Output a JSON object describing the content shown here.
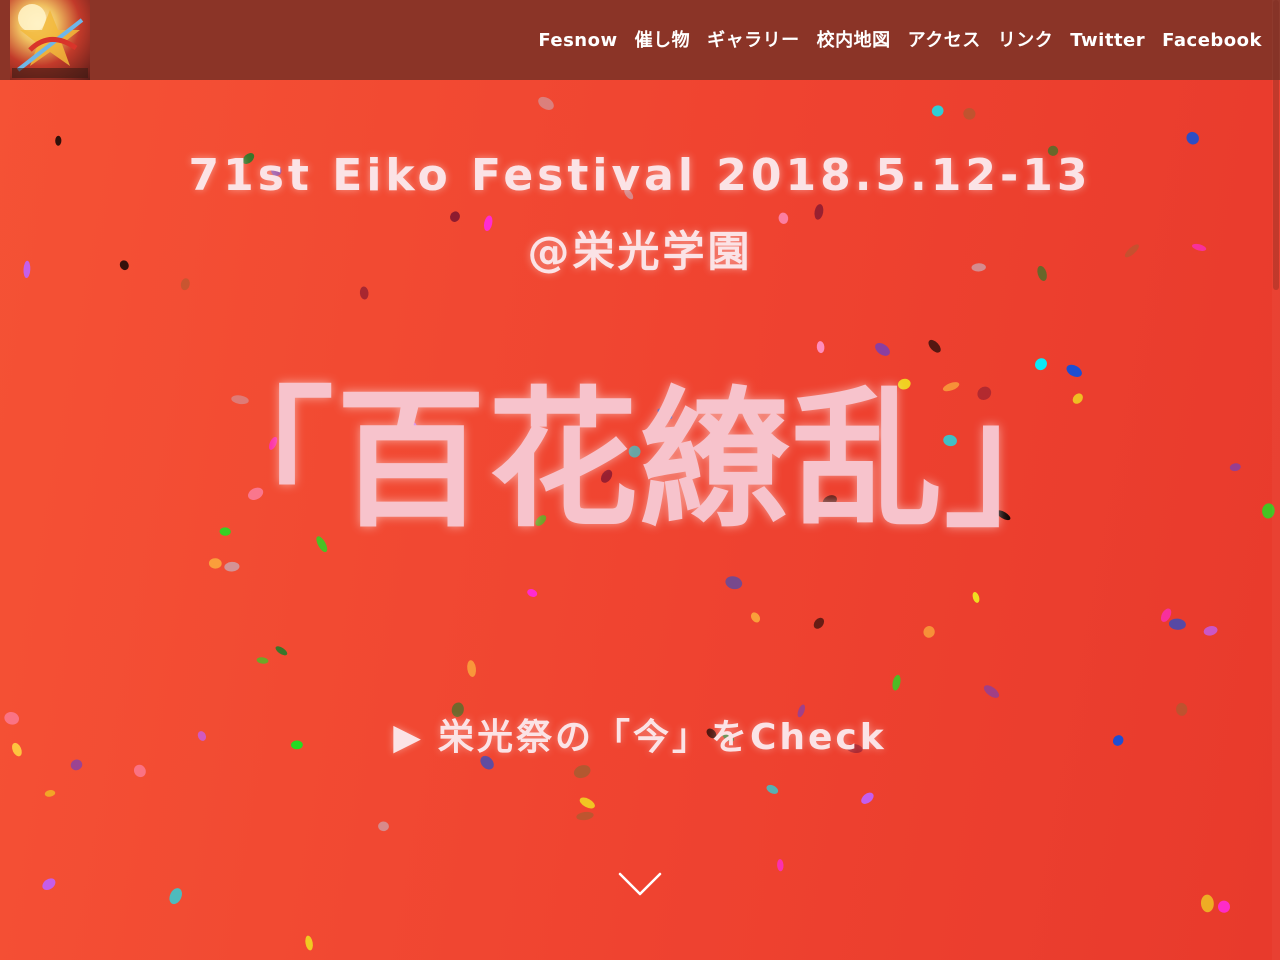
{
  "header": {
    "logo_alt": "栄光祭 logo",
    "nav": [
      {
        "label": "Fesnow"
      },
      {
        "label": "催し物"
      },
      {
        "label": "ギャラリー"
      },
      {
        "label": "校内地図"
      },
      {
        "label": "アクセス"
      },
      {
        "label": "リンク"
      },
      {
        "label": "Twitter"
      },
      {
        "label": "Facebook"
      }
    ]
  },
  "hero": {
    "line1": "71st Eiko Festival 2018.5.12-13",
    "line2": "@栄光学園",
    "title": "「百花繚乱」",
    "check_arrow": "▶",
    "check_label": "栄光祭の「今」をCheck",
    "scroll_icon": "chevron-down-icon"
  },
  "colors": {
    "background": "#ef4330",
    "header": "#8b3427",
    "title": "#f7c3cc",
    "text": "#fbe3e6"
  }
}
